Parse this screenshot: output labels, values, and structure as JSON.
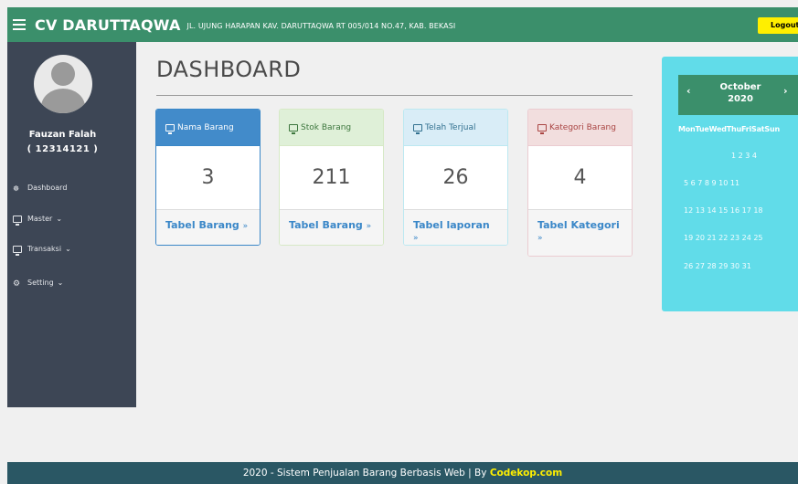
{
  "header": {
    "brand": "CV DARUTTAQWA",
    "address": "JL. UJUNG HARAPAN KAV. DARUTTAQWA RT 005/014 NO.47, KAB. BEKASI",
    "logout_label": "Logout"
  },
  "sidebar": {
    "user_name": "Fauzan Falah",
    "user_id": "( 12314121 )",
    "items": [
      {
        "label": "Dashboard",
        "icon": "dashboard-icon"
      },
      {
        "label": "Master",
        "icon": "monitor-icon"
      },
      {
        "label": "Transaksi",
        "icon": "monitor-icon"
      },
      {
        "label": "Setting",
        "icon": "gear-icon"
      }
    ],
    "dropdown_marker": "⌄"
  },
  "main": {
    "title": "DASHBOARD",
    "cards": [
      {
        "title": "Nama Barang",
        "value": "3",
        "link": "Tabel Barang",
        "accent": "#428bca"
      },
      {
        "title": "Stok Barang",
        "value": "211",
        "link": "Tabel Barang",
        "accent": "#dff0d8"
      },
      {
        "title": "Telah Terjual",
        "value": "26",
        "link": "Tabel laporan",
        "accent": "#d9edf7"
      },
      {
        "title": "Kategori Barang",
        "value": "4",
        "link": "Tabel Kategori",
        "accent": "#f2dede"
      }
    ],
    "link_arrow": "»"
  },
  "calendar": {
    "month": "October",
    "year": "2020",
    "prev": "‹",
    "next": "›",
    "weekdays": "MonTueWedThuFriSatSun",
    "rows": [
      "1  2  3  4",
      "5  6  7  8  9  10  11",
      "12  13  14  15  16 17  18",
      "19  20  21  22 23 24  25",
      "26  27  28  29 30 31"
    ],
    "bg_color": "#61dce9",
    "header_color": "#3b8f6b"
  },
  "footer": {
    "text": "2020 - Sistem Penjualan Barang Berbasis Web | By ",
    "link": "Codekop.com"
  }
}
